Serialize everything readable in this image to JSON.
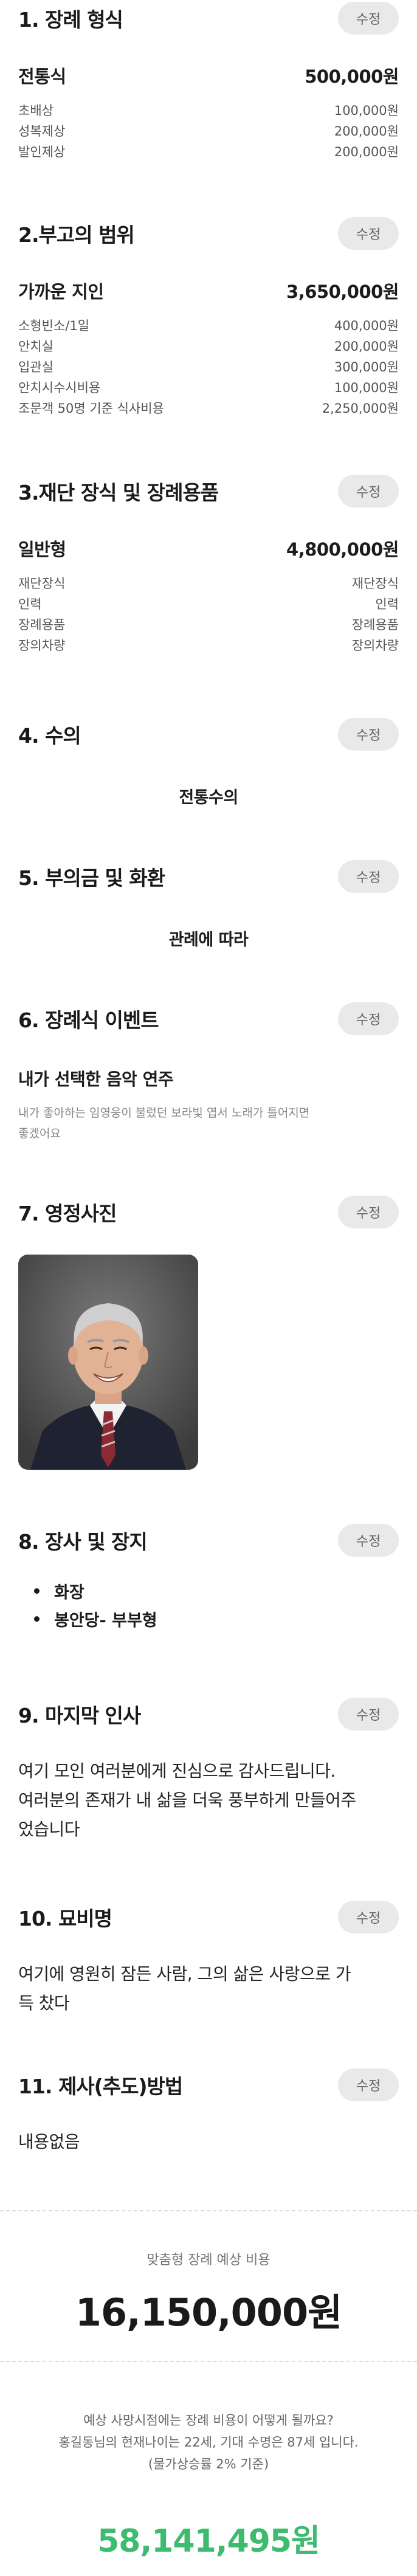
{
  "edit_label": "수정",
  "s1": {
    "title": "1. 장례 형식",
    "package_name": "전통식",
    "package_price": "500,000원",
    "items": [
      {
        "name": "초배상",
        "price": "100,000원"
      },
      {
        "name": "성복제상",
        "price": "200,000원"
      },
      {
        "name": "발인제상",
        "price": "200,000원"
      }
    ]
  },
  "s2": {
    "title": "2.부고의 범위",
    "package_name": "가까운 지인",
    "package_price": "3,650,000원",
    "items": [
      {
        "name": "소형빈소/1일",
        "price": "400,000원"
      },
      {
        "name": "안치실",
        "price": "200,000원"
      },
      {
        "name": "입관실",
        "price": "300,000원"
      },
      {
        "name": "안치시수시비용",
        "price": "100,000원"
      },
      {
        "name": "조문객 50명 기준 식사비용",
        "price": "2,250,000원"
      }
    ]
  },
  "s3": {
    "title": "3.재단 장식 및 장례용품",
    "package_name": "일반형",
    "package_price": "4,800,000원",
    "items": [
      {
        "name": "재단장식",
        "price": "재단장식"
      },
      {
        "name": "인력",
        "price": "인력"
      },
      {
        "name": "장례용품",
        "price": "장례용품"
      },
      {
        "name": "장의차량",
        "price": "장의차량"
      }
    ]
  },
  "s4": {
    "title": "4. 수의",
    "value": "전통수의"
  },
  "s5": {
    "title": "5. 부의금 및 화환",
    "value": "관례에 따라"
  },
  "s6": {
    "title": "6. 장례식 이벤트",
    "event_title": "내가 선택한 음악 연주",
    "event_desc_1": "내가 좋아하는 임영웅이 불렀던 보라빛 엽서 노래가 틀어지면",
    "event_desc_2": "좋겠어요"
  },
  "s7": {
    "title": "7. 영정사진",
    "photo_icon": "portrait-photo"
  },
  "s8": {
    "title": "8. 장사 및 장지",
    "items": [
      "화장",
      "봉안당- 부부형"
    ]
  },
  "s9": {
    "title": "9. 마지막 인사",
    "lines": [
      "여기 모인 여러분에게 진심으로 감사드립니다.",
      "여러분의 존재가 내 삶을 더욱 풍부하게 만들어주",
      "었습니다"
    ]
  },
  "s10": {
    "title": "10. 묘비명",
    "lines": [
      "여기에 영원히 잠든 사람, 그의 삶은 사랑으로 가",
      "득 찼다"
    ]
  },
  "s11": {
    "title": "11.  제사(추도)방법",
    "value": "내용없음"
  },
  "total": {
    "label": "맞춤형 장례 예상 비용",
    "value": "16,150,000원"
  },
  "future": {
    "question": "예상 사망시점에는 장례 비용이 어떻게 될까요?",
    "line2": "홍길동님의 현재나이는 22세, 기대 수명은 87세 입니다.",
    "line3": "(물가상승률 2% 기준)",
    "value": "58,141,495원"
  },
  "colors": {
    "accent_green": "#3dbb6f",
    "button_bg": "#e9e9e9"
  }
}
